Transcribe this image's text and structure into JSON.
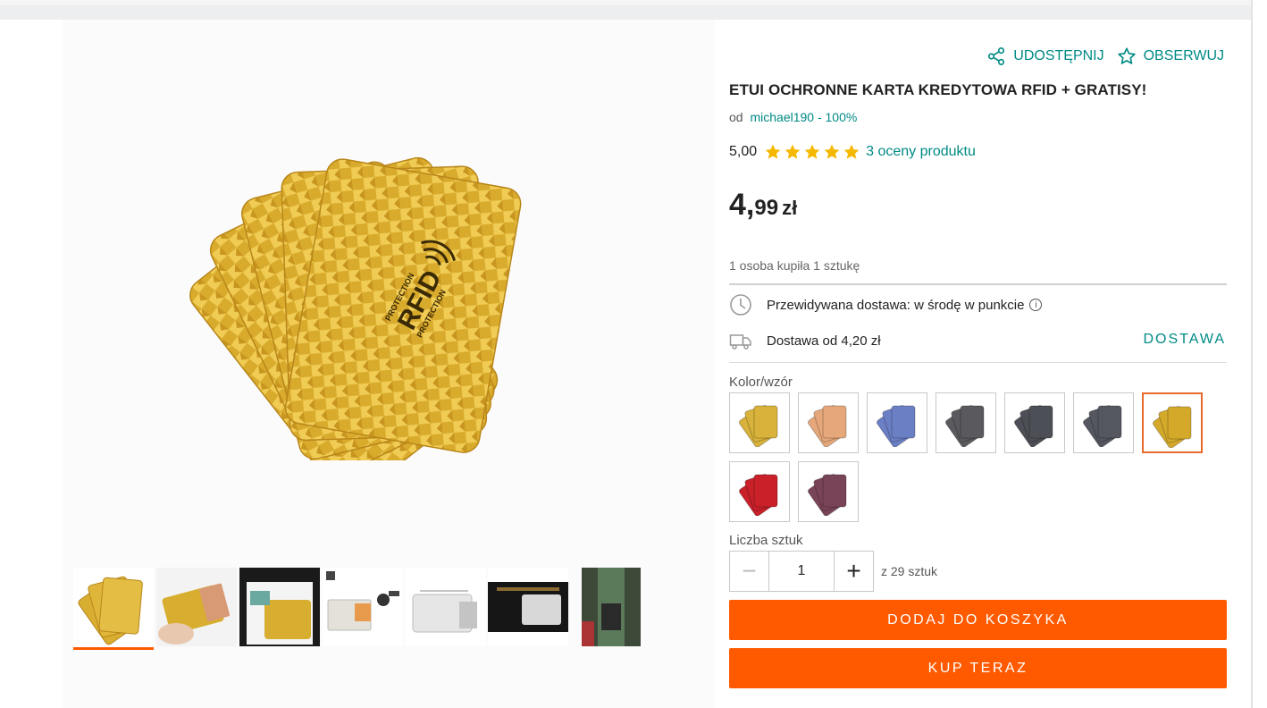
{
  "header": {
    "share_label": "UDOSTĘPNIJ",
    "share_icon": "share-icon",
    "watch_label": "OBSERWUJ",
    "watch_icon": "star-outline-icon"
  },
  "product": {
    "title": "ETUI OCHRONNE KARTA KREDYTOWA RFID + GRATISY!",
    "seller_prefix": "od",
    "seller_link": "michael190 - 100%",
    "rating_value": "5,00",
    "rating_stars": 5,
    "rating_count_label": "3 oceny produktu",
    "price_int": "4,",
    "price_dec": "99",
    "price_currency": "zł",
    "sold_text": "1 osoba kupiła 1 sztukę",
    "main_image_text_top": "PROTECTION",
    "main_image_text_main": "RFID",
    "main_image_text_bottom": "PROTECTION"
  },
  "delivery": {
    "estimate_text": "Przewidywana dostawa: w środę w punkcie",
    "info_glyph": "i",
    "cost_text": "Dostawa od 4,20 zł",
    "link_label": "DOSTAWA"
  },
  "variants": {
    "label": "Kolor/wzór",
    "colors": [
      "#d8b23a",
      "#e6a77a",
      "#6b7fc4",
      "#5a5a5e",
      "#4d4f56",
      "#555760",
      "#d4a92a",
      "#c9202a",
      "#7a4458"
    ],
    "selected_index": 6
  },
  "quantity": {
    "label": "Liczba sztuk",
    "value": "1",
    "minus_glyph": "−",
    "plus_glyph": "+",
    "of_text": "z 29 sztuk"
  },
  "buttons": {
    "add_to_cart": "DODAJ DO KOSZYKA",
    "buy_now": "KUP TERAZ"
  },
  "thumbnails": {
    "active_index": 0,
    "items": [
      "gold-cards",
      "gold-card-in-hand",
      "gold-cards-notebook",
      "silver-sleeve-keys",
      "silver-rfid-sleeve",
      "wallet-silver-card",
      "person-outdoor"
    ]
  },
  "theme": {
    "accent": "#ff5a00",
    "link": "#008a85",
    "star": "#f5b800"
  }
}
